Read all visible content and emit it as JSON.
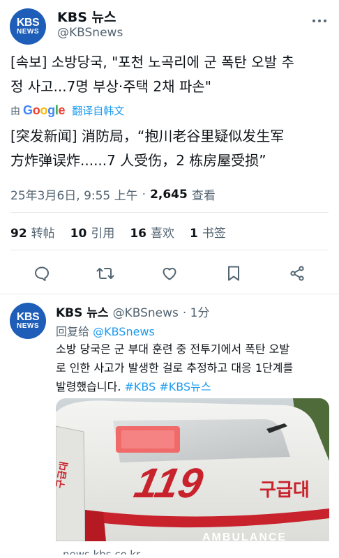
{
  "main_tweet": {
    "account_name": "KBS 뉴스",
    "account_handle": "@KBSnews",
    "avatar_line1": "KBS",
    "avatar_line2": "NEWS",
    "korean_line1": "[속보] 소방당국, \"포천 노곡리에 군 폭탄 오발 추",
    "korean_line2": "정 사고...7명 부상·주택 2채 파손\"",
    "translated_by": "由",
    "google_label": "Google",
    "translate_label": "翻译自韩文",
    "chinese_line1": "[突发新闻] 消防局，“抱川老谷里疑似发生军",
    "chinese_line2": "方炸弹误炸......7 人受伤，2 栋房屋受损”",
    "timestamp": "25年3月6日, 9:55 上午",
    "separator": "·",
    "views_count": "2,645",
    "views_label": "查看"
  },
  "stats": {
    "reposts_count": "92",
    "reposts_label": "转帖",
    "quotes_count": "10",
    "quotes_label": "引用",
    "likes_count": "16",
    "likes_label": "喜欢",
    "bookmarks_count": "1",
    "bookmarks_label": "书签"
  },
  "actions": [
    "reply-icon",
    "retweet-icon",
    "heart-icon",
    "bookmark-icon",
    "share-icon"
  ],
  "reply_tweet": {
    "account_name": "KBS 뉴스",
    "account_handle": "@KBSnews",
    "time": "· 1分",
    "avatar_line1": "KBS",
    "avatar_line2": "NEWS",
    "reply_prefix": "回复给",
    "reply_mention": "@KBSnews",
    "body_line1": "소방 당국은 군 부대 훈련 중 전투기에서 폭탄 오발",
    "body_line2": "로 인한 사고가 발생한 걸로 추정하고 대응 1단계를",
    "body_line3_text": "발령했습니다.",
    "hashtag1": "#KBS",
    "hashtag2": "#KBS뉴스",
    "media_text_119": "119",
    "media_text_ambulance_kr": "구급대",
    "media_text_ambulance_en": "AMBULANCE",
    "link_caption": "news.kbs.co.kr"
  },
  "colors": {
    "text": "#0f1419",
    "muted": "#536471",
    "link": "#1d9bf0",
    "kbs_blue": "#1e5db8",
    "ambulance_red": "#c8232c"
  }
}
